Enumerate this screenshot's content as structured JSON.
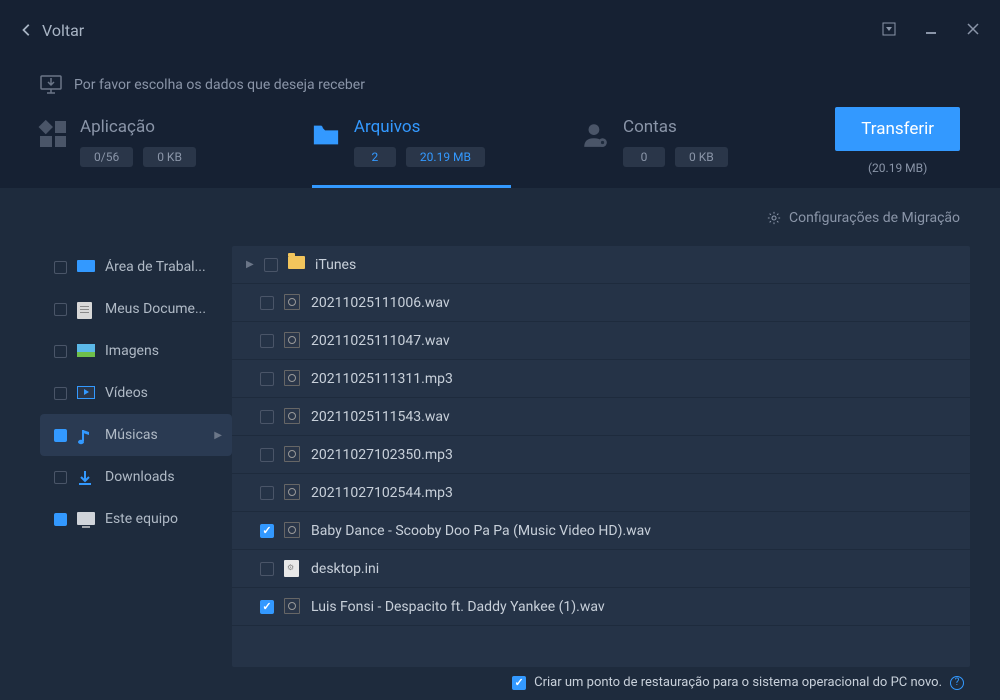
{
  "titlebar": {
    "back": "Voltar"
  },
  "instruction": "Por favor escolha os dados que deseja receber",
  "tabs": {
    "app": {
      "label": "Aplicação",
      "count": "0/56",
      "size": "0 KB"
    },
    "files": {
      "label": "Arquivos",
      "count": "2",
      "size": "20.19 MB"
    },
    "accounts": {
      "label": "Contas",
      "count": "0",
      "size": "0 KB"
    }
  },
  "transfer": {
    "button": "Transferir",
    "size": "(20.19 MB)"
  },
  "settings": "Configurações de Migração",
  "sidebar": {
    "items": [
      {
        "label": "Área de Trabal...",
        "type": "desk",
        "checked": false
      },
      {
        "label": "Meus Docume...",
        "type": "docs",
        "checked": false
      },
      {
        "label": "Imagens",
        "type": "img",
        "checked": false
      },
      {
        "label": "Vídeos",
        "type": "vid",
        "checked": false
      },
      {
        "label": "Músicas",
        "type": "music",
        "checked": true,
        "selected": true
      },
      {
        "label": "Downloads",
        "type": "dl",
        "checked": false
      },
      {
        "label": "Este equipo",
        "type": "pc",
        "checked": true
      }
    ]
  },
  "files": [
    {
      "name": "iTunes",
      "type": "folder",
      "checked": false,
      "expandable": true
    },
    {
      "name": "20211025111006.wav",
      "type": "audio",
      "checked": false
    },
    {
      "name": "20211025111047.wav",
      "type": "audio",
      "checked": false
    },
    {
      "name": "20211025111311.mp3",
      "type": "audio",
      "checked": false
    },
    {
      "name": "20211025111543.wav",
      "type": "audio",
      "checked": false
    },
    {
      "name": "20211027102350.mp3",
      "type": "audio",
      "checked": false
    },
    {
      "name": "20211027102544.mp3",
      "type": "audio",
      "checked": false
    },
    {
      "name": "Baby Dance - Scooby Doo Pa Pa (Music Video HD).wav",
      "type": "audio",
      "checked": true
    },
    {
      "name": "desktop.ini",
      "type": "ini",
      "checked": false
    },
    {
      "name": "Luis Fonsi - Despacito ft. Daddy Yankee (1).wav",
      "type": "audio",
      "checked": true
    }
  ],
  "footer": {
    "restore": "Criar um ponto de restauração para o sistema operacional do PC novo."
  }
}
